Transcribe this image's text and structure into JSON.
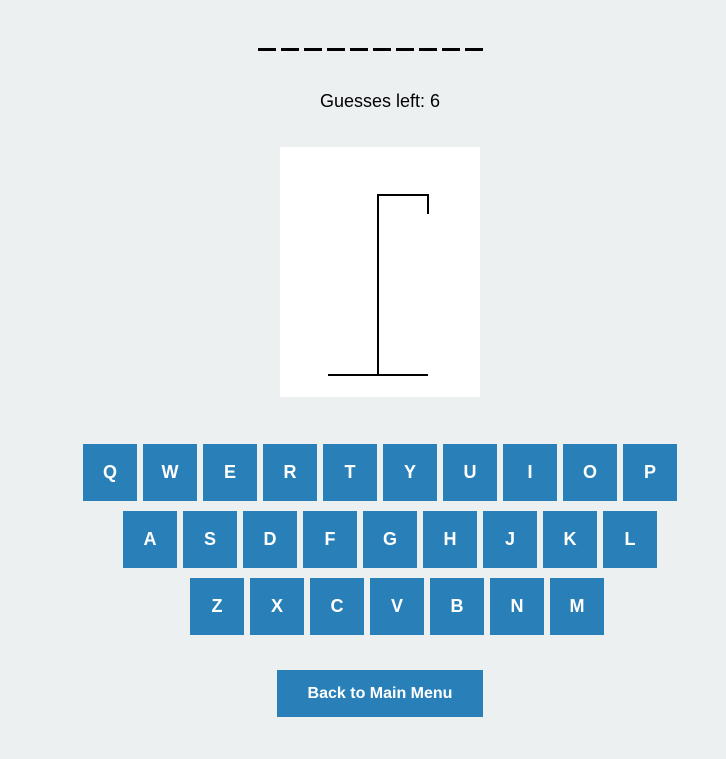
{
  "word": {
    "letters": [
      "",
      "",
      "",
      "",
      "",
      "",
      "",
      "",
      "",
      ""
    ]
  },
  "guesses": {
    "label": "Guesses left: 6",
    "count": 6
  },
  "keyboard": {
    "row1": [
      "Q",
      "W",
      "E",
      "R",
      "T",
      "Y",
      "U",
      "I",
      "O",
      "P"
    ],
    "row2": [
      "A",
      "S",
      "D",
      "F",
      "G",
      "H",
      "J",
      "K",
      "L"
    ],
    "row3": [
      "Z",
      "X",
      "C",
      "V",
      "B",
      "N",
      "M"
    ]
  },
  "back_button": {
    "label": "Back to Main Menu"
  },
  "colors": {
    "background": "#ecf0f1",
    "key": "#2980b9",
    "key_text": "#ffffff"
  }
}
